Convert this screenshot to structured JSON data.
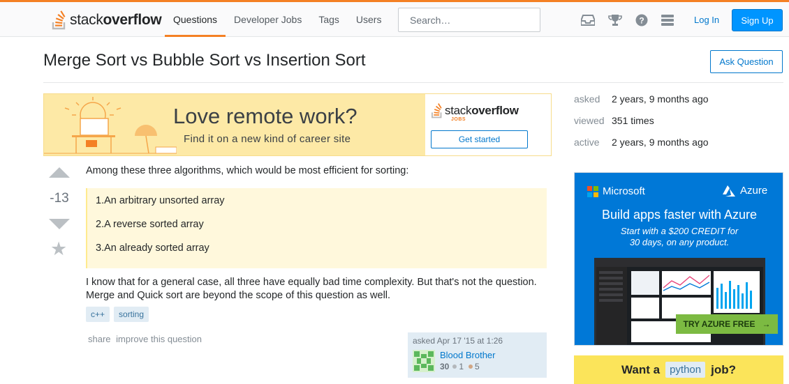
{
  "header": {
    "logo_text_light": "stack",
    "logo_text_bold": "overflow",
    "nav": [
      "Questions",
      "Developer Jobs",
      "Tags",
      "Users"
    ],
    "search_placeholder": "Search…",
    "login_label": "Log In",
    "signup_label": "Sign Up",
    "icons": [
      "inbox-icon",
      "achievements-icon",
      "help-icon",
      "site-switcher-icon"
    ]
  },
  "question": {
    "title": "Merge Sort vs Bubble Sort vs Insertion Sort",
    "ask_button": "Ask Question",
    "votes": "-13",
    "intro": "Among these three algorithms, which would be most efficient for sorting:",
    "quote_items": [
      "1.An arbitrary unsorted array",
      "2.A reverse sorted array",
      "3.An already sorted array"
    ],
    "body": "I know that for a general case, all three have equally bad time complexity. But that's not the question. Merge and Quick sort are beyond the scope of this question as well.",
    "tags": [
      "c++",
      "sorting"
    ],
    "menu": [
      "share",
      "improve this question"
    ],
    "owner": {
      "asked_text": "asked Apr 17 '15 at 1:26",
      "name": "Blood Brother",
      "reputation": "30",
      "silver": "1",
      "bronze": "5"
    }
  },
  "stats": {
    "asked_label": "asked",
    "asked_value": "2 years, 9 months ago",
    "viewed_label": "viewed",
    "viewed_value": "351 times",
    "active_label": "active",
    "active_value": "2 years, 9 months ago"
  },
  "jobs_ad": {
    "headline": "Love remote work?",
    "sub": "Find it on a new kind of career site",
    "logo_light": "stack",
    "logo_bold": "overflow",
    "jobs_tag": "JOBS",
    "cta": "Get started"
  },
  "ms_ad": {
    "brand": "Microsoft",
    "product": "Azure",
    "headline": "Build apps faster with Azure",
    "sub_line1": "Start with a $200 CREDIT for",
    "sub_line2": "30 days, on any product.",
    "cta": "TRY AZURE FREE",
    "cta_arrow": "→"
  },
  "python_ad": {
    "prefix": "Want a",
    "tag": "python",
    "suffix": "job?"
  },
  "colors": {
    "accent": "#f48024",
    "link": "#0077cc",
    "primary_button": "#0095ff",
    "tag_bg": "#e1ecf4",
    "quote_bg": "#fff8dc",
    "azure_blue": "#0078d7"
  }
}
